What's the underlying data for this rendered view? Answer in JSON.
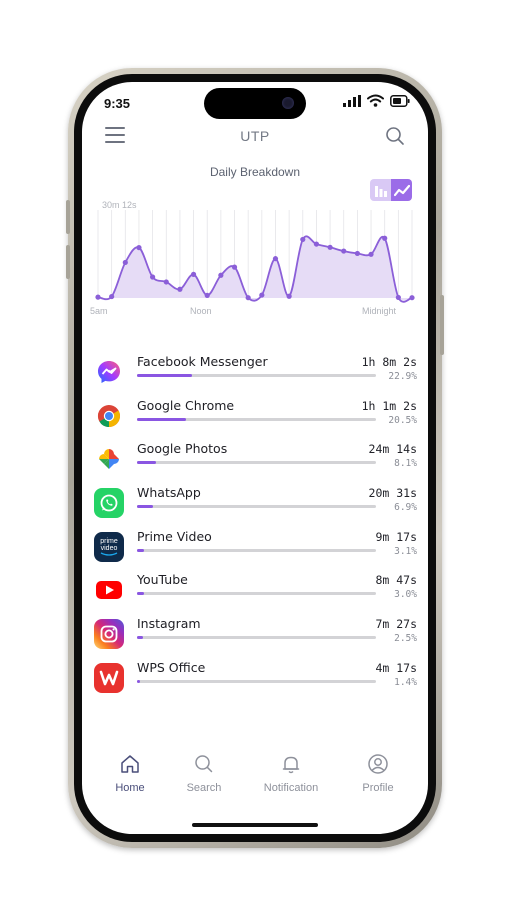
{
  "status": {
    "time": "9:35"
  },
  "header": {
    "title": "UTP"
  },
  "chart_data": {
    "type": "area",
    "title": "Daily Breakdown",
    "y_top_label": "30m 12s",
    "x_tick_labels": [
      "5am",
      "Noon",
      "Midnight"
    ],
    "x": [
      0,
      1,
      2,
      3,
      4,
      5,
      6,
      7,
      8,
      9,
      10,
      11,
      12,
      13,
      14,
      15,
      16,
      17,
      18,
      19,
      20,
      21,
      22,
      23
    ],
    "values": [
      0.3,
      0.5,
      12.2,
      17.3,
      7.2,
      5.5,
      3.0,
      8.1,
      0.9,
      7.8,
      10.6,
      0.1,
      1.0,
      13.5,
      0.6,
      20.1,
      18.5,
      17.4,
      16.1,
      15.3,
      15.0,
      20.5,
      0.2,
      0.1
    ],
    "yunit": "minutes",
    "ylim": [
      0,
      30.2
    ],
    "color": "#8b5fd8",
    "fill": "#e6dcf6"
  },
  "toggle": {
    "bar_icon": "bar-chart-icon",
    "line_icon": "line-chart-icon",
    "selected": "line"
  },
  "apps": [
    {
      "name": "Facebook Messenger",
      "time": "1h 8m 2s",
      "percent": "22.9%",
      "share": 0.229,
      "icon": "messenger-icon"
    },
    {
      "name": "Google Chrome",
      "time": "1h 1m 2s",
      "percent": "20.5%",
      "share": 0.205,
      "icon": "chrome-icon"
    },
    {
      "name": "Google Photos",
      "time": "24m 14s",
      "percent": "8.1%",
      "share": 0.081,
      "icon": "photos-icon"
    },
    {
      "name": "WhatsApp",
      "time": "20m 31s",
      "percent": "6.9%",
      "share": 0.069,
      "icon": "whatsapp-icon"
    },
    {
      "name": "Prime Video",
      "time": "9m 17s",
      "percent": "3.1%",
      "share": 0.031,
      "icon": "prime-video-icon"
    },
    {
      "name": "YouTube",
      "time": "8m 47s",
      "percent": "3.0%",
      "share": 0.03,
      "icon": "youtube-icon"
    },
    {
      "name": "Instagram",
      "time": "7m 27s",
      "percent": "2.5%",
      "share": 0.025,
      "icon": "instagram-icon"
    },
    {
      "name": "WPS Office",
      "time": "4m 17s",
      "percent": "1.4%",
      "share": 0.014,
      "icon": "wps-office-icon"
    }
  ],
  "prime_icon_text": "prime video",
  "tabs": [
    {
      "label": "Home",
      "icon": "home-icon",
      "active": true
    },
    {
      "label": "Search",
      "icon": "search-icon",
      "active": false
    },
    {
      "label": "Notification",
      "icon": "bell-icon",
      "active": false
    },
    {
      "label": "Profile",
      "icon": "profile-icon",
      "active": false
    }
  ],
  "colors": {
    "accent": "#8b5fd8",
    "accent_light": "#d9c9f5",
    "track": "#d3d3d6"
  }
}
